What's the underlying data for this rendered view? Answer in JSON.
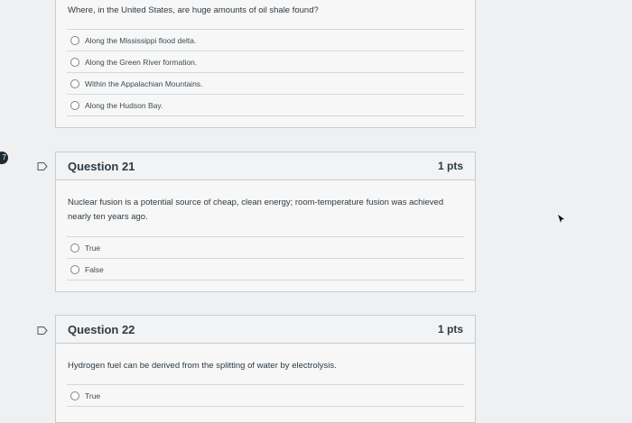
{
  "badge": "7",
  "q20": {
    "text": "Where, in the United States, are huge amounts of oil shale found?",
    "options": [
      "Along the Mississippi flood delta.",
      "Along the Green River formation.",
      "Within the Appalachian Mountains.",
      "Along the Hudson Bay."
    ]
  },
  "q21": {
    "title": "Question 21",
    "points": "1 pts",
    "text": "Nuclear fusion is a potential source of cheap, clean energy; room-temperature fusion was achieved nearly ten years ago.",
    "options": [
      "True",
      "False"
    ]
  },
  "q22": {
    "title": "Question 22",
    "points": "1 pts",
    "text": "Hydrogen fuel can be derived from the splitting of water by electrolysis.",
    "options": [
      "True"
    ]
  },
  "icons": {
    "flag": "flag-question-icon",
    "cursor": "mouse-pointer-icon"
  }
}
